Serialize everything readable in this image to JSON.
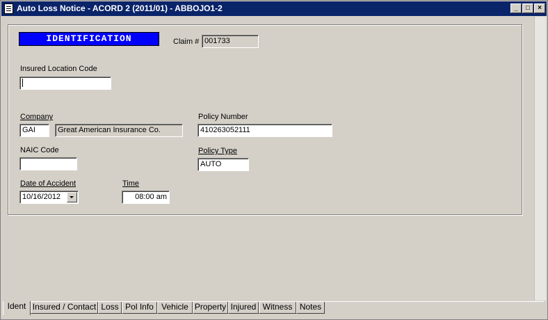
{
  "window": {
    "title": "Auto Loss Notice - ACORD 2 (2011/01) - ABBOJO1-2"
  },
  "section": {
    "header": "IDENTIFICATION"
  },
  "claim": {
    "label": "Claim #",
    "value": "001733"
  },
  "insured_location": {
    "label": "Insured Location Code",
    "value": ""
  },
  "company": {
    "label": "Company",
    "code": "GAI",
    "name": "Great American Insurance Co."
  },
  "policy_number": {
    "label": "Policy Number",
    "value": "410263052111"
  },
  "naic": {
    "label": "NAIC Code",
    "value": ""
  },
  "policy_type": {
    "label": "Policy Type",
    "value": "AUTO"
  },
  "date_of_accident": {
    "label": "Date of Accident",
    "value": "10/16/2012"
  },
  "time": {
    "label": "Time",
    "value": "08:00 am"
  },
  "tabs": [
    {
      "label": "Ident"
    },
    {
      "label": "Insured / Contact"
    },
    {
      "label": "Loss"
    },
    {
      "label": "Pol Info"
    },
    {
      "label": "Vehicle"
    },
    {
      "label": "Property"
    },
    {
      "label": "Injured"
    },
    {
      "label": "Witness"
    },
    {
      "label": "Notes"
    }
  ],
  "colors": {
    "titlebar": "#0a246a",
    "header_bg": "#0000ff",
    "face": "#d4d0c8"
  },
  "icons": {
    "app": "document-icon",
    "minimize": "minimize-icon",
    "maximize": "maximize-icon",
    "close": "close-icon"
  }
}
